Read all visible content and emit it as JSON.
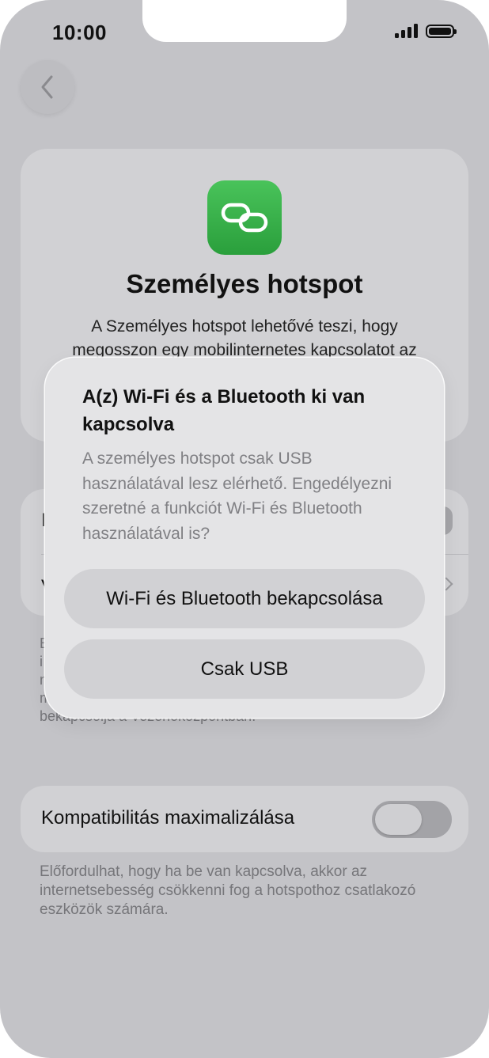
{
  "status_bar": {
    "time": "10:00"
  },
  "hero": {
    "title": "Személyes hotspot",
    "description": "A Személyes hotspot lehetővé teszi, hogy megosszon egy mobilinternetes kapcsolatot az"
  },
  "settings_peek": {
    "row1_initial": "I",
    "row2_initial": "V"
  },
  "hint": {
    "visible_fragments": [
      "E",
      "i",
      "n",
      "m",
      "bekapcsolja a Vezérlőközpontban."
    ]
  },
  "compatibility": {
    "label": "Kompatibilitás maximalizálása",
    "enabled": false,
    "description": "Előfordulhat, hogy ha be van kapcsolva, akkor az internetsebesség csökkenni fog a hotspothoz csatlakozó eszközök számára."
  },
  "dialog": {
    "title": "A(z) Wi-Fi és a Bluetooth ki van kapcsolva",
    "message": "A személyes hotspot csak USB használatával lesz elérhető. Engedélyezni szeretné a funkciót Wi-Fi és Bluetooth használatával is?",
    "primary_button": "Wi-Fi és Bluetooth bekapcsolása",
    "secondary_button": "Csak USB"
  },
  "colors": {
    "background": "#c3c3c7",
    "card": "#d1d1d4",
    "dialog": "#e4e4e6",
    "icon_green": "#34b24a"
  },
  "icons": {
    "back": "chevron-left-icon",
    "app": "link-icon"
  }
}
